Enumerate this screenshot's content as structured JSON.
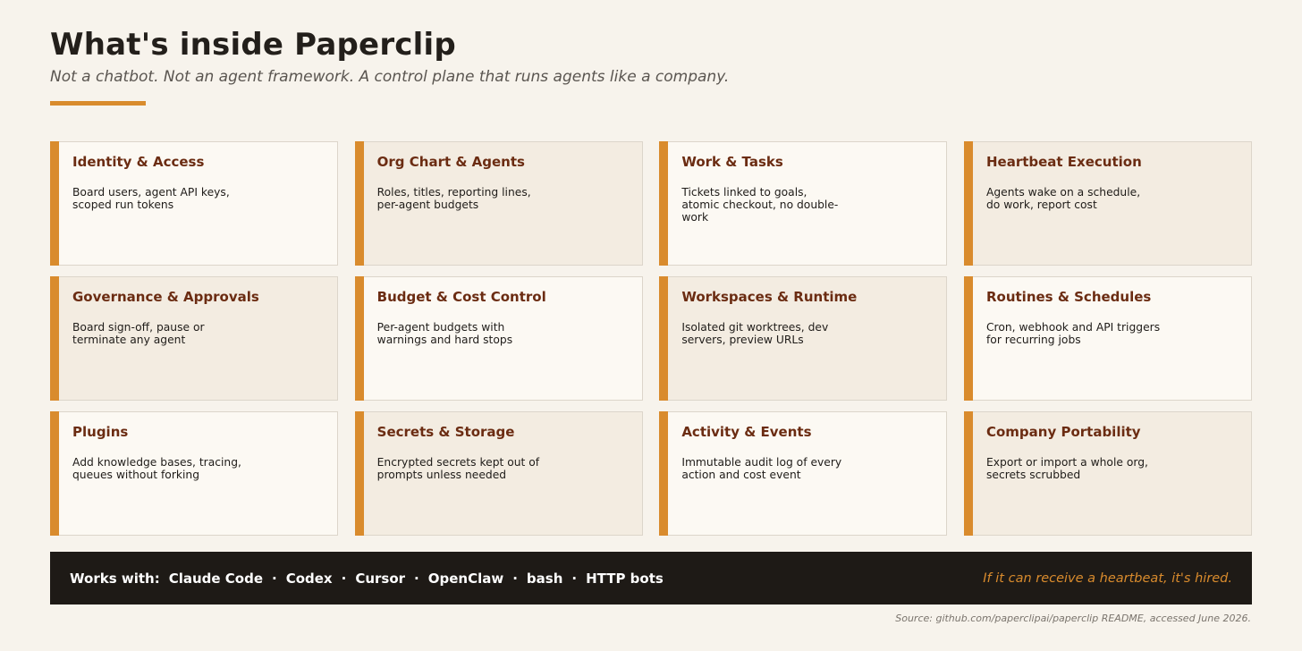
{
  "header": {
    "title": "What's inside Paperclip",
    "subtitle": "Not a chatbot. Not an agent framework. A control plane that runs agents like a company."
  },
  "colors": {
    "accent": "#d98b2d",
    "card_title": "#6b2c12",
    "footer_bg": "#1e1a16",
    "page_bg": "#f7f3ec"
  },
  "cards": [
    {
      "title": "Identity & Access",
      "desc": "Board users, agent API keys, scoped run tokens"
    },
    {
      "title": "Org Chart & Agents",
      "desc": "Roles, titles, reporting lines, per-agent budgets"
    },
    {
      "title": "Work & Tasks",
      "desc": "Tickets linked to goals, atomic checkout, no double-work"
    },
    {
      "title": "Heartbeat Execution",
      "desc": "Agents wake on a schedule, do work, report cost"
    },
    {
      "title": "Governance & Approvals",
      "desc": "Board sign-off, pause or terminate any agent"
    },
    {
      "title": "Budget & Cost Control",
      "desc": "Per-agent budgets with warnings and hard stops"
    },
    {
      "title": "Workspaces & Runtime",
      "desc": "Isolated git worktrees, dev servers, preview URLs"
    },
    {
      "title": "Routines & Schedules",
      "desc": "Cron, webhook and API triggers for recurring jobs"
    },
    {
      "title": "Plugins",
      "desc": "Add knowledge bases, tracing, queues without forking"
    },
    {
      "title": "Secrets & Storage",
      "desc": "Encrypted secrets kept out of prompts unless needed"
    },
    {
      "title": "Activity & Events",
      "desc": "Immutable audit log of every action and cost event"
    },
    {
      "title": "Company Portability",
      "desc": "Export or import a whole org, secrets scrubbed"
    }
  ],
  "footer": {
    "works_with_label": "Works with:",
    "separator": "·",
    "tools": [
      "Claude Code",
      "Codex",
      "Cursor",
      "OpenClaw",
      "bash",
      "HTTP bots"
    ],
    "tagline": "If it can receive a heartbeat, it's hired."
  },
  "source": "Source: github.com/paperclipai/paperclip README, accessed June 2026."
}
